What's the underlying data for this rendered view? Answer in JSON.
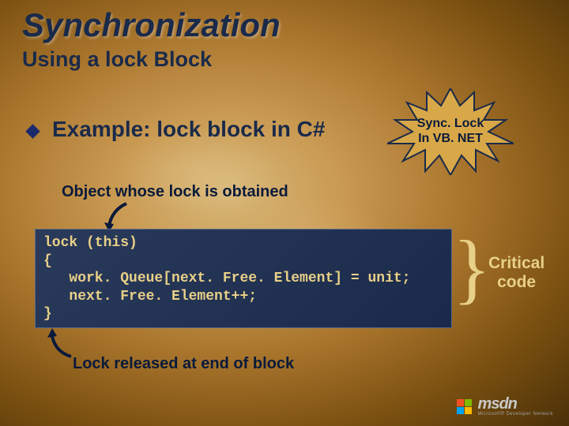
{
  "title": "Synchronization",
  "subtitle": "Using a lock Block",
  "bullet": "Example: lock block in C#",
  "starburst": {
    "line1": "Sync. Lock",
    "line2": "In VB. NET"
  },
  "annotation_top": "Object whose lock is obtained",
  "code": {
    "l1": "lock (this)",
    "l2": "{",
    "l3": "   work. Queue[next. Free. Element] = unit;",
    "l4": "   next. Free. Element++;",
    "l5": "}"
  },
  "brace": "}",
  "critical": {
    "line1": "Critical",
    "line2": "code"
  },
  "annotation_bottom": "Lock released at end of block",
  "logo": {
    "text": "msdn",
    "sub": "Microsoft® Developer Network"
  }
}
